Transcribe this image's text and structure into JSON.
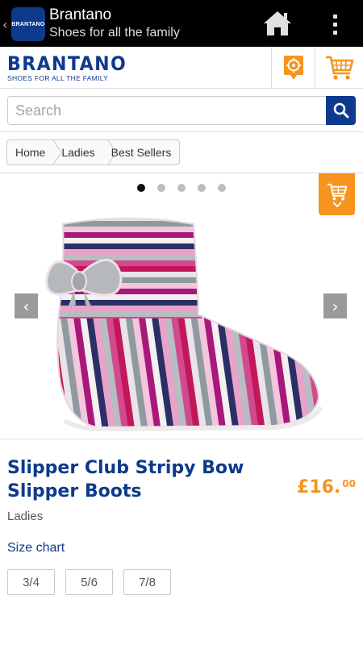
{
  "app": {
    "back_icon": "chevron-left-icon",
    "icon_label": "BRANTANO",
    "title": "Brantano",
    "subtitle": "Shoes for all the family",
    "home_icon": "home-icon",
    "overflow_icon": "overflow-menu-icon"
  },
  "header": {
    "logo_text": "BRANTANO",
    "logo_tagline": "SHOES FOR ALL THE FAMILY",
    "store_icon": "store-locator-icon",
    "cart_icon": "cart-icon"
  },
  "search": {
    "placeholder": "Search",
    "value": "",
    "icon": "search-icon"
  },
  "breadcrumb": [
    "Home",
    "Ladies",
    "Best Sellers"
  ],
  "carousel": {
    "dots": 5,
    "active_dot": 0,
    "prev_icon": "chevron-left-icon",
    "next_icon": "chevron-right-icon",
    "cart_tab_icon": "cart-icon",
    "image_subject": "striped knitted slipper boot with bow"
  },
  "product": {
    "name": "Slipper Club Stripy Bow Slipper Boots",
    "price_main": "£16.",
    "price_cents": "00",
    "category": "Ladies",
    "size_chart_label": "Size chart",
    "sizes": [
      "3/4",
      "5/6",
      "7/8"
    ]
  },
  "colors": {
    "brand_blue": "#0d3a8c",
    "accent_orange": "#f7941d",
    "action_bar": "#000000"
  }
}
